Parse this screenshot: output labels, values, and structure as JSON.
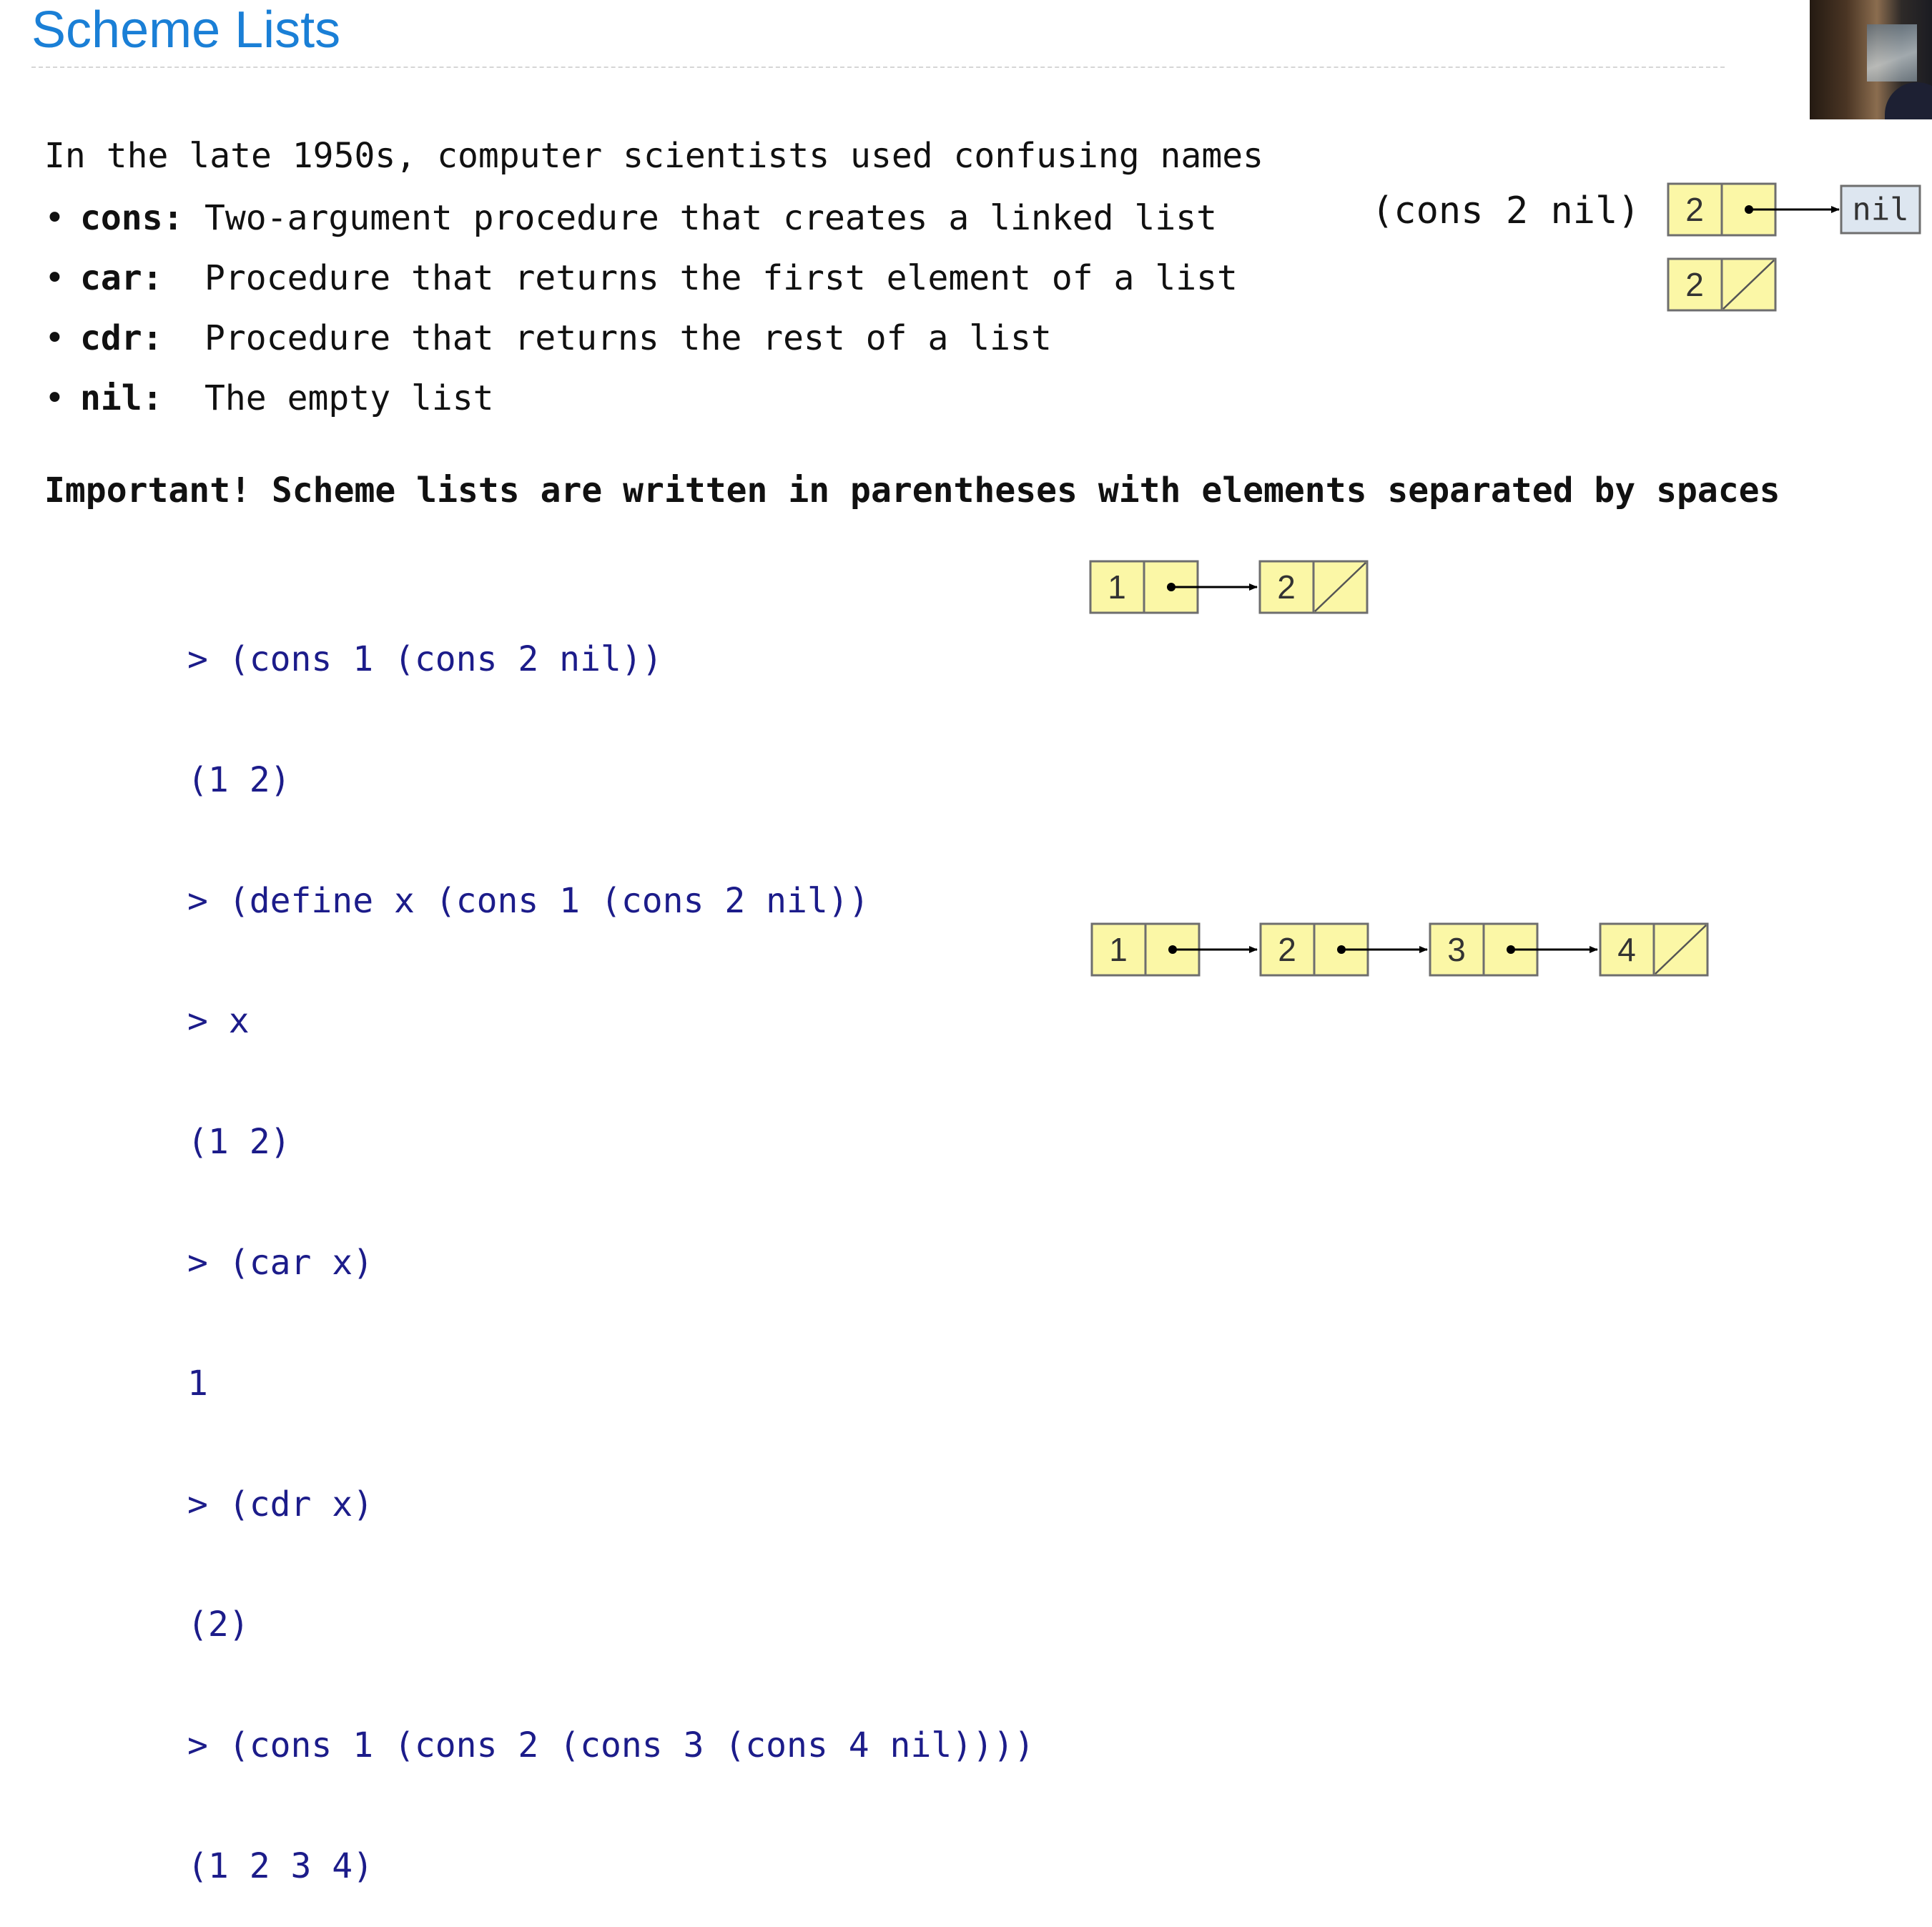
{
  "slide": {
    "title": "Scheme Lists",
    "intro": "In the late 1950s, computer scientists used confusing names",
    "bullets": [
      {
        "term": "cons:",
        "description": "Two-argument procedure that creates a linked list"
      },
      {
        "term": "car:",
        "description": "Procedure that returns the first element of a list"
      },
      {
        "term": "cdr:",
        "description": "Procedure that returns the rest of a list"
      },
      {
        "term": "nil:",
        "description": "The empty list"
      }
    ],
    "important": "Important! Scheme lists are written in parentheses with elements separated by spaces",
    "cons_example_label": "(cons 2 nil)",
    "code_lines": [
      "> (cons 1 (cons 2 nil))",
      "(1 2)",
      "> (define x (cons 1 (cons 2 nil))",
      "> x",
      "(1 2)",
      "> (car x)",
      "1",
      "> (cdr x)",
      "(2)",
      "> (cons 1 (cons 2 (cons 3 (cons 4 nil))))",
      "(1 2 3 4)"
    ]
  },
  "diagrams": {
    "cons_2_nil": {
      "values": [
        "2"
      ],
      "terminator": "nil"
    },
    "single_2": {
      "values": [
        "2"
      ]
    },
    "list_1_2": {
      "values": [
        "1",
        "2"
      ]
    },
    "list_1_2_3_4": {
      "values": [
        "1",
        "2",
        "3",
        "4"
      ]
    }
  },
  "colors": {
    "title": "#1a7fd6",
    "code": "#1c1c8a",
    "box_fill": "#fbf7a6",
    "nil_fill": "#dde6f0"
  }
}
